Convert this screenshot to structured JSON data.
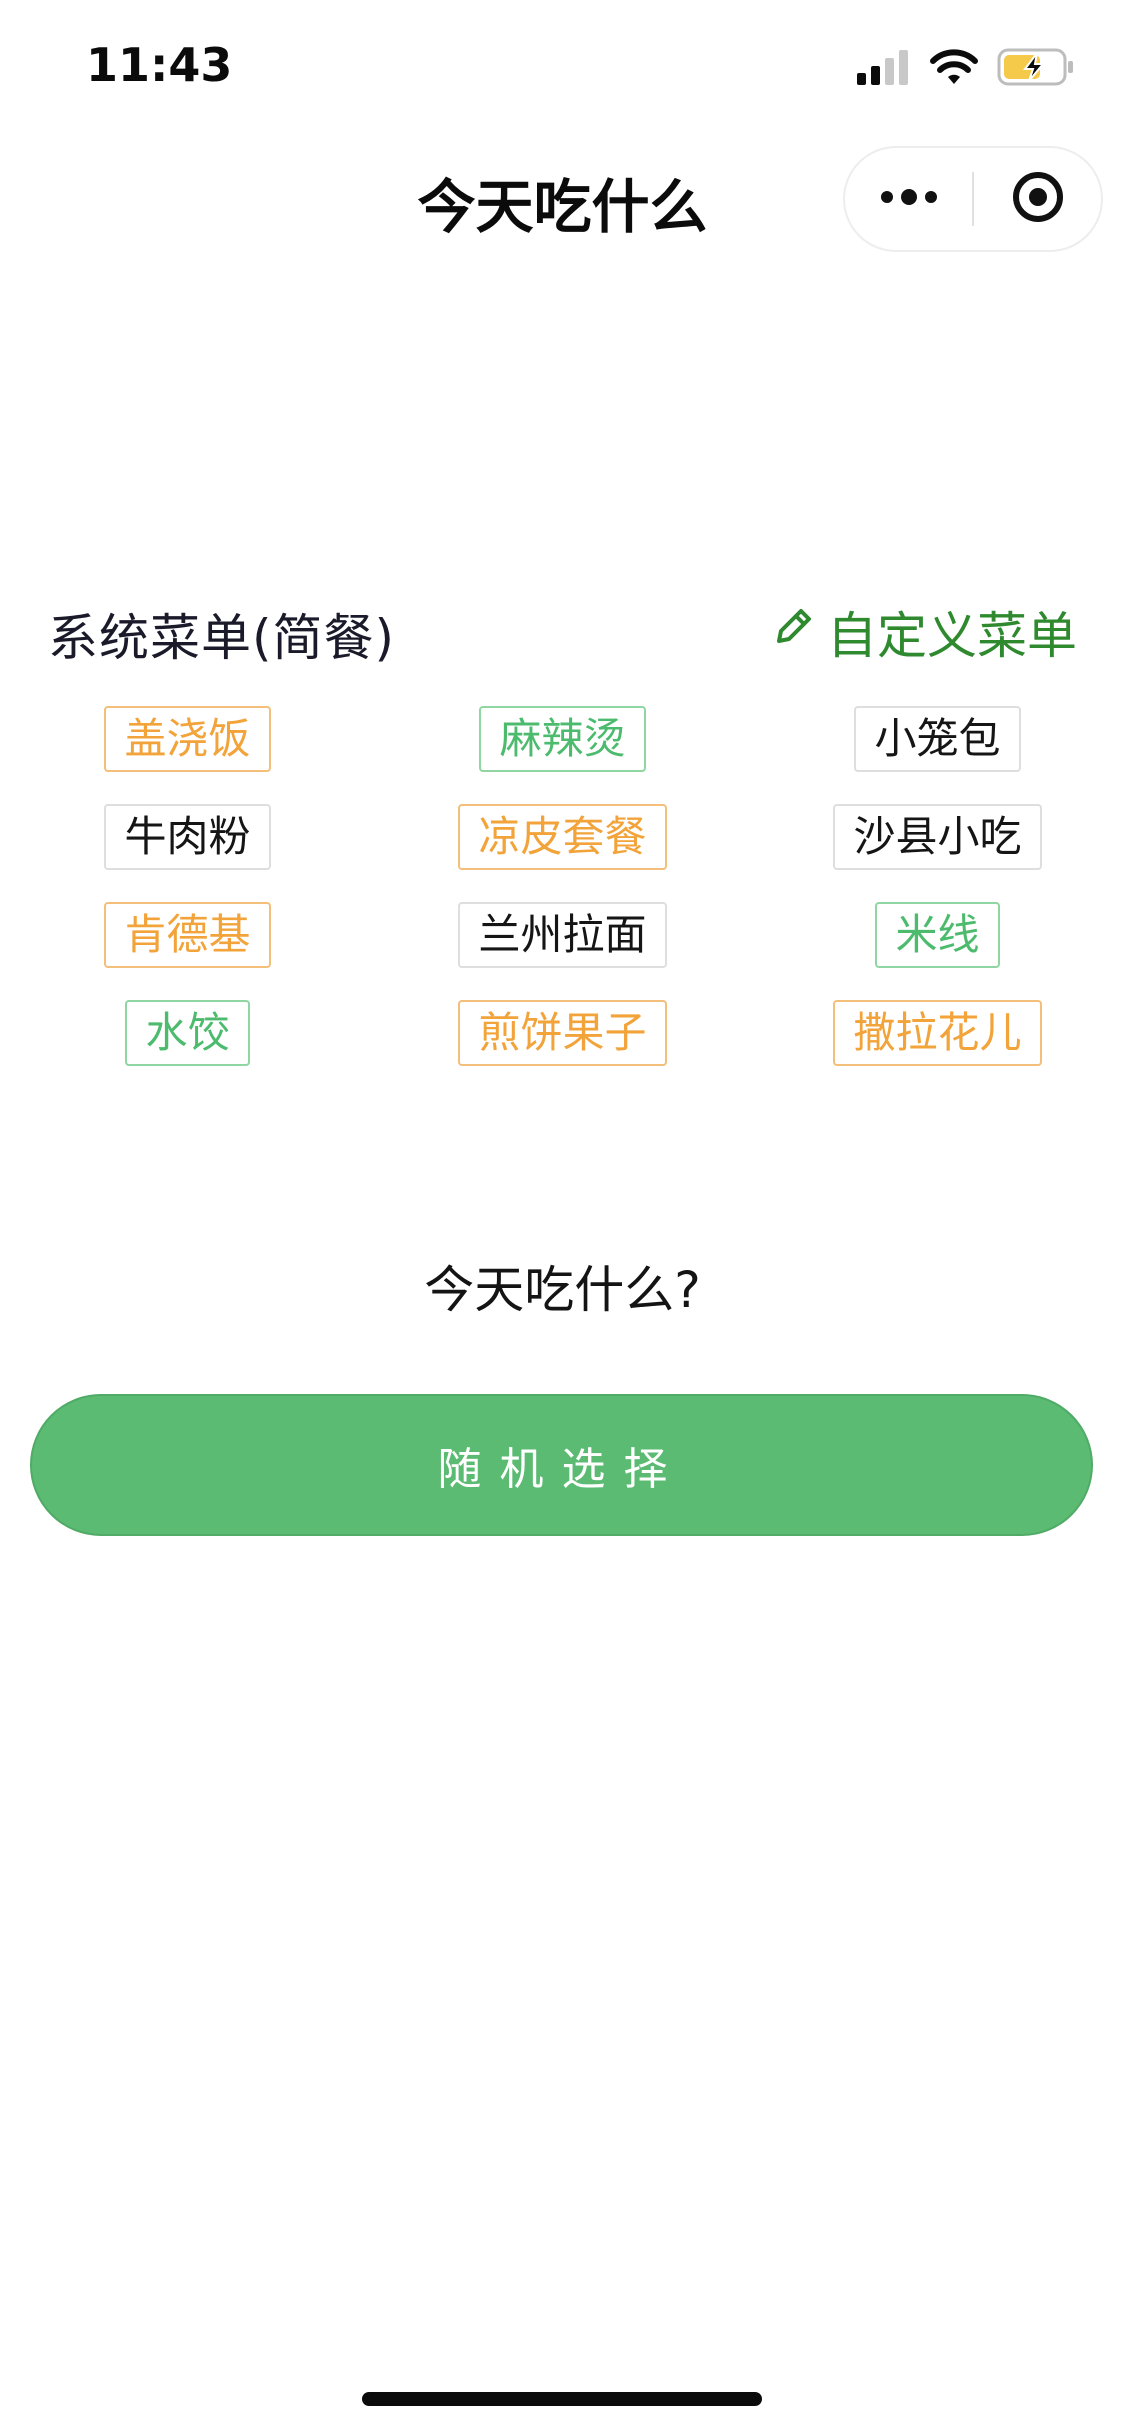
{
  "status_bar": {
    "time": "11:43",
    "icons": [
      "signal-icon",
      "wifi-icon",
      "battery-charging-icon"
    ],
    "battery_color": "#f5c94a"
  },
  "nav": {
    "title": "今天吃什么",
    "capsule_icons": [
      "more-dots-icon",
      "close-target-icon"
    ]
  },
  "section": {
    "title": "系统菜单(简餐)",
    "custom_link_label": "自定义菜单",
    "custom_link_icon": "pencil-icon"
  },
  "colors": {
    "orange": "#f2a33a",
    "green": "#4dbb6e",
    "black": "#151515",
    "accent_green": "#2f8a2f",
    "button_green": "#5bbb73"
  },
  "menu": {
    "rows": [
      [
        {
          "label": "盖浇饭",
          "color": "orange"
        },
        {
          "label": "麻辣烫",
          "color": "green"
        },
        {
          "label": "小笼包",
          "color": "black"
        }
      ],
      [
        {
          "label": "牛肉粉",
          "color": "black"
        },
        {
          "label": "凉皮套餐",
          "color": "orange"
        },
        {
          "label": "沙县小吃",
          "color": "black"
        }
      ],
      [
        {
          "label": "肯德基",
          "color": "orange"
        },
        {
          "label": "兰州拉面",
          "color": "black"
        },
        {
          "label": "米线",
          "color": "green"
        }
      ],
      [
        {
          "label": "水饺",
          "color": "green"
        },
        {
          "label": "煎饼果子",
          "color": "orange"
        },
        {
          "label": "撒拉花儿",
          "color": "orange"
        }
      ]
    ]
  },
  "question": "今天吃什么?",
  "random_button_label": "随机选择"
}
